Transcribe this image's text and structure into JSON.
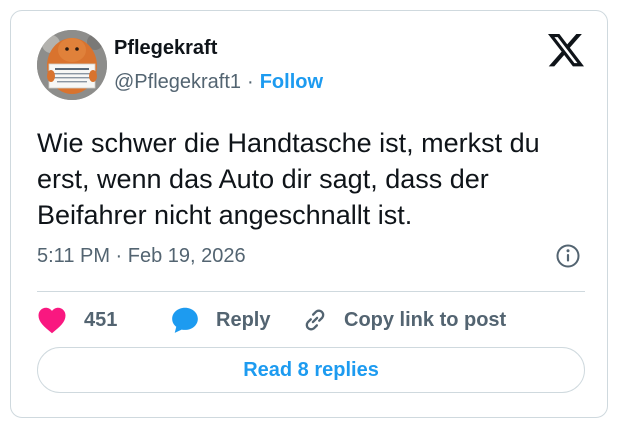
{
  "author": {
    "display_name": "Pflegekraft",
    "handle": "@Pflegekraft1",
    "separator": "·",
    "follow_label": "Follow",
    "avatar_icon": "knitted-figure-holding-sign-avatar"
  },
  "brand": {
    "logo_icon": "x-logo-icon"
  },
  "tweet": {
    "text": "Wie schwer die Handtasche ist, merkst du erst, wenn das Auto dir sagt, dass der Beifahrer nicht angeschnallt ist.",
    "timestamp": "5:11 PM · Feb 19, 2026"
  },
  "actions": {
    "like_count": "451",
    "reply_label": "Reply",
    "copy_link_label": "Copy link to post"
  },
  "footer": {
    "read_replies_label": "Read 8 replies"
  },
  "colors": {
    "accent": "#1d9bf0",
    "like": "#f91880",
    "text_primary": "#0f1419",
    "text_secondary": "#536471",
    "border": "#cfd9de"
  }
}
